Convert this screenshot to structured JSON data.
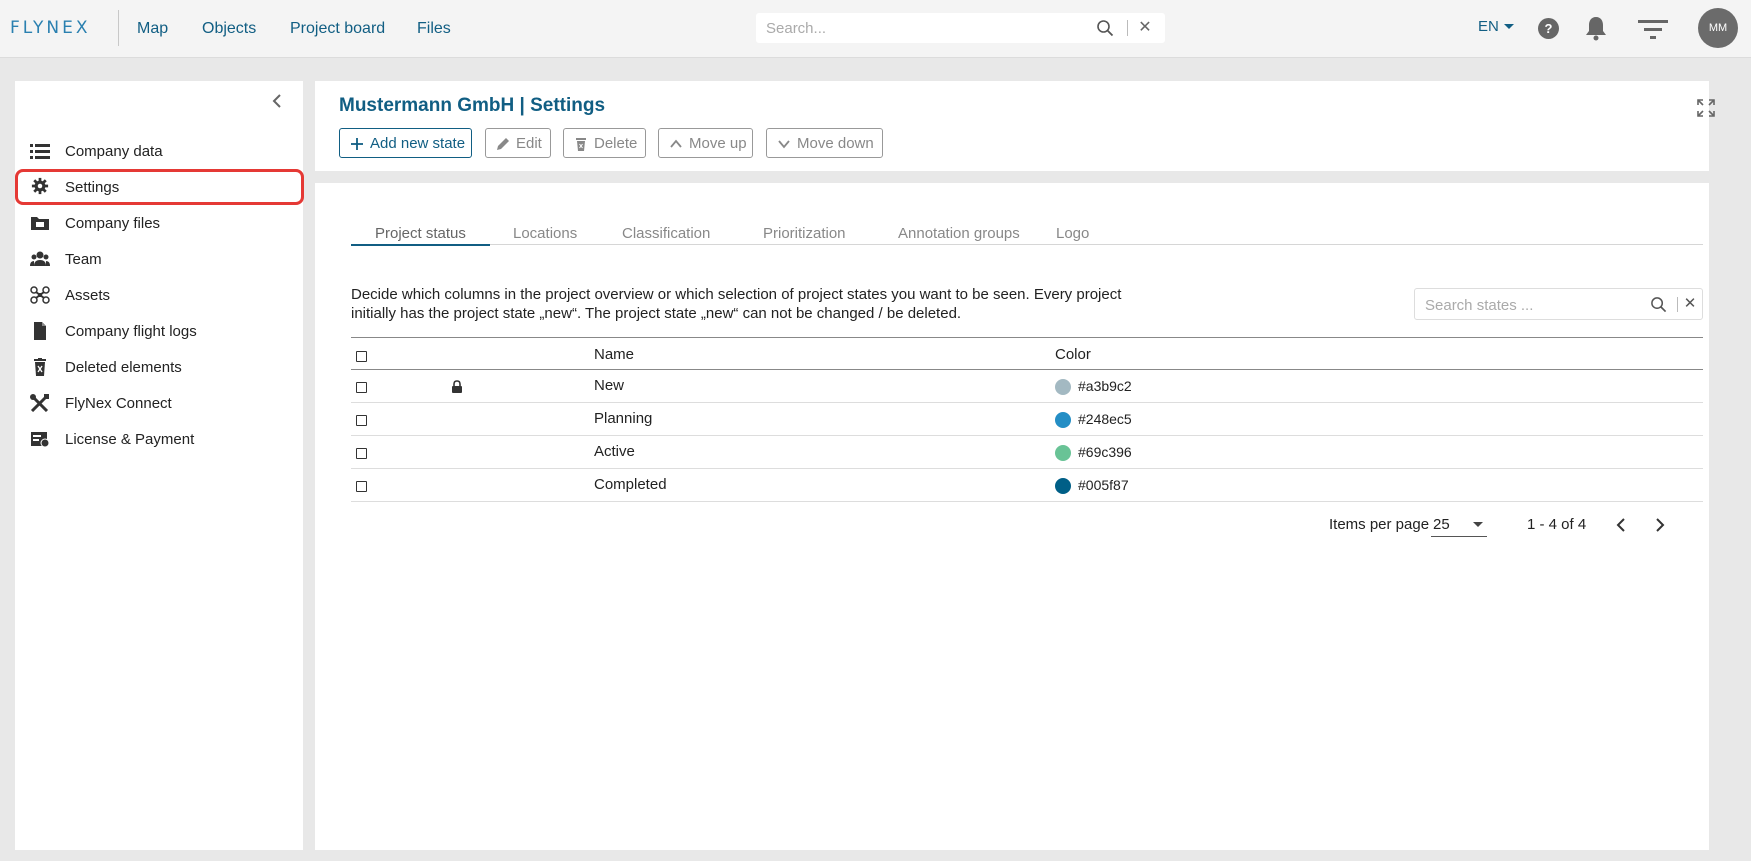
{
  "topbar": {
    "logo": "FLYNEX",
    "nav": [
      "Map",
      "Objects",
      "Project board",
      "Files"
    ],
    "search_placeholder": "Search...",
    "language": "EN",
    "user_initials": "MM"
  },
  "sidebar": {
    "items": [
      {
        "label": "Company data",
        "icon": "list-icon"
      },
      {
        "label": "Settings",
        "icon": "gear-icon",
        "active": true
      },
      {
        "label": "Company files",
        "icon": "folder-icon"
      },
      {
        "label": "Team",
        "icon": "team-icon"
      },
      {
        "label": "Assets",
        "icon": "drone-icon"
      },
      {
        "label": "Company flight logs",
        "icon": "file-icon"
      },
      {
        "label": "Deleted elements",
        "icon": "trash-icon"
      },
      {
        "label": "FlyNex Connect",
        "icon": "tools-icon"
      },
      {
        "label": "License & Payment",
        "icon": "license-icon"
      }
    ]
  },
  "header": {
    "title": "Mustermann GmbH | Settings",
    "buttons": {
      "add": "Add new state",
      "edit": "Edit",
      "delete": "Delete",
      "move_up": "Move up",
      "move_down": "Move down"
    }
  },
  "main": {
    "tabs": [
      "Project status",
      "Locations",
      "Classification",
      "Prioritization",
      "Annotation groups",
      "Logo"
    ],
    "active_tab": "Project status",
    "description": "Decide which columns in the project overview or which selection of project states you want to be seen. Every project initially has the project state „new“. The project state „new“ can not be changed / be deleted.",
    "states_search_placeholder": "Search states ...",
    "table": {
      "headers": {
        "name": "Name",
        "color": "Color"
      },
      "rows": [
        {
          "name": "New",
          "color": "#a3b9c2",
          "locked": true
        },
        {
          "name": "Planning",
          "color": "#248ec5",
          "locked": false
        },
        {
          "name": "Active",
          "color": "#69c396",
          "locked": false
        },
        {
          "name": "Completed",
          "color": "#005f87",
          "locked": false
        }
      ]
    },
    "pagination": {
      "items_per_page_label": "Items per page",
      "items_per_page": "25",
      "range": "1 - 4 of 4"
    }
  },
  "colors": {
    "brand": "#115e83",
    "highlight": "#e53935"
  }
}
